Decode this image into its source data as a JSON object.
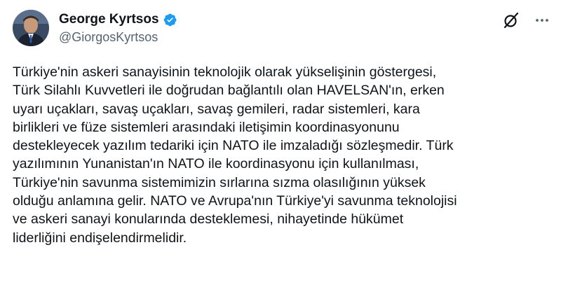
{
  "author": {
    "display_name": "George Kyrtsos",
    "handle": "@GiorgosKyrtsos",
    "verified": true
  },
  "icons": {
    "verified": "verified-badge-icon",
    "grok": "grok-icon",
    "more": "more-options-icon"
  },
  "colors": {
    "verified_blue": "#1d9bf0",
    "text": "#0f1419",
    "secondary_text": "#536471"
  },
  "tweet": {
    "text": "Türkiye'nin askeri sanayisinin teknolojik olarak yükselişinin göstergesi,\nTürk Silahlı Kuvvetleri ile doğrudan bağlantılı olan HAVELSAN'ın, erken\nuyarı uçakları, savaş uçakları, savaş gemileri, radar sistemleri, kara\nbirlikleri ve füze sistemleri arasındaki iletişimin koordinasyonunu\ndestekleyecek yazılım tedariki için NATO ile imzaladığı sözleşmedir. Türk\nyazılımının Yunanistan'ın NATO ile koordinasyonu için kullanılması,\nTürkiye'nin savunma sistemimizin sırlarına sızma olasılığının yüksek\nolduğu anlamına gelir. NATO ve Avrupa'nın Türkiye'yi savunma teknolojisi\nve askeri sanayi konularında desteklemesi, nihayetinde hükümet\nliderliğini endişelendirmelidir."
  }
}
